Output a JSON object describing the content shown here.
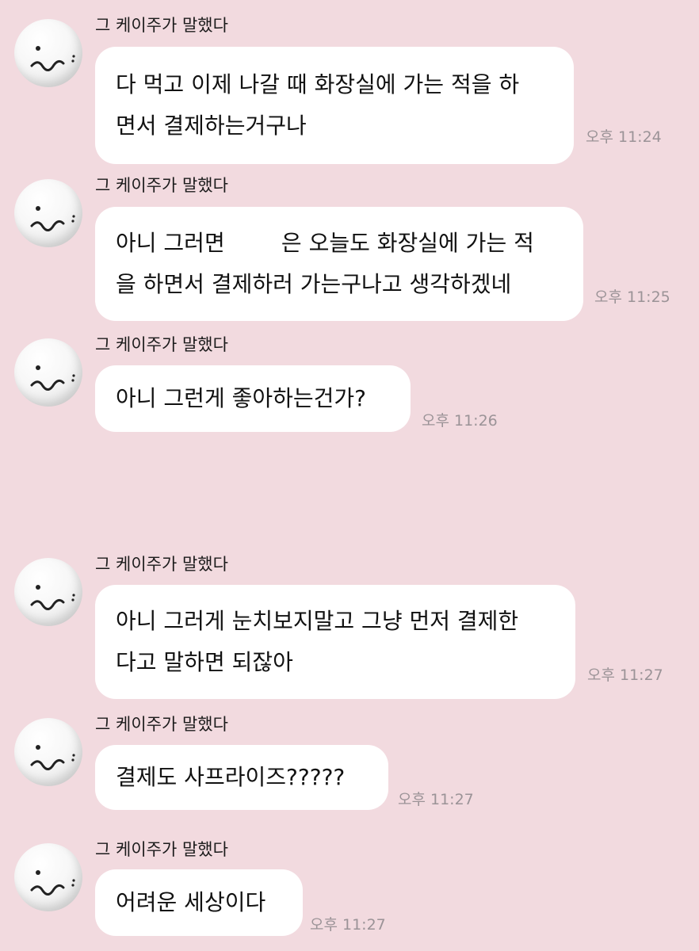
{
  "messages": [
    {
      "sender": "그 케이주가 말했다",
      "text": "다 먹고 이제 나갈 때 화장실에 가는 적을 하\n면서 결제하는거구나",
      "time": "오후 11:24"
    },
    {
      "sender": "그 케이주가 말했다",
      "text": "아니 그러면        은 오늘도 화장실에 가는 적\n을 하면서 결제하러 가는구나고 생각하겠네",
      "time": "오후 11:25"
    },
    {
      "sender": "그 케이주가 말했다",
      "text": "아니 그런게 좋아하는건가?",
      "time": "오후 11:26"
    },
    {
      "sender": "그 케이주가 말했다",
      "text": "아니 그러게 눈치보지말고 그냥 먼저 결제한\n다고 말하면 되잖아",
      "time": "오후 11:27"
    },
    {
      "sender": "그 케이주가 말했다",
      "text": "결제도 사프라이즈?????",
      "time": "오후 11:27"
    },
    {
      "sender": "그 케이주가 말했다",
      "text": "어려운 세상이다",
      "time": "오후 11:27"
    }
  ],
  "avatar": {
    "icon": "round-face-avatar-icon",
    "color": "#f5f5f5"
  },
  "colors": {
    "background": "#f2dadf",
    "bubble": "#ffffff",
    "timestamp": "#9b9397"
  }
}
